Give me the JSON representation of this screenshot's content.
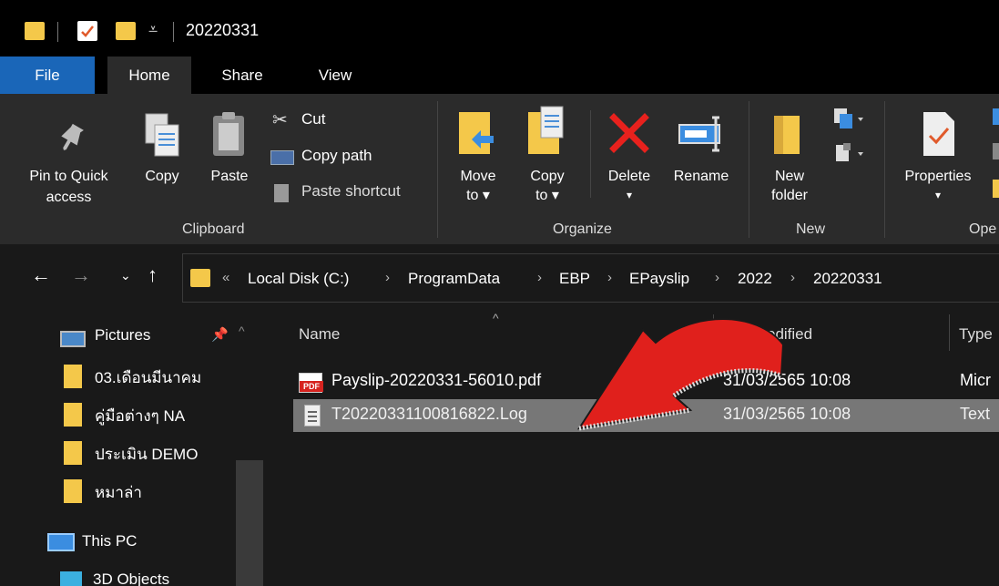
{
  "window": {
    "title": "20220331"
  },
  "tabs": [
    {
      "label": "File"
    },
    {
      "label": "Home"
    },
    {
      "label": "Share"
    },
    {
      "label": "View"
    }
  ],
  "ribbon": {
    "clipboard": {
      "pin_line1": "Pin to Quick",
      "pin_line2": "access",
      "copy": "Copy",
      "paste": "Paste",
      "cut": "Cut",
      "copy_path": "Copy path",
      "paste_shortcut": "Paste shortcut",
      "group": "Clipboard"
    },
    "organize": {
      "move_line1": "Move",
      "move_line2": "to ▾",
      "copy_line1": "Copy",
      "copy_line2": "to ▾",
      "delete": "Delete",
      "delete_arrow": "▾",
      "rename": "Rename",
      "group": "Organize"
    },
    "new": {
      "folder_line1": "New",
      "folder_line2": "folder",
      "group": "New"
    },
    "open": {
      "properties": "Properties",
      "properties_arrow": "▾",
      "group": "Ope"
    }
  },
  "address": {
    "overflow": "«",
    "crumbs": [
      "Local Disk (C:)",
      "ProgramData",
      "EBP",
      "EPayslip",
      "2022",
      "20220331"
    ],
    "sep": "›"
  },
  "sidebar": {
    "items": [
      {
        "label": "Pictures"
      },
      {
        "label": "03.เดือนมีนาคม"
      },
      {
        "label": "คู่มือต่างๆ NA"
      },
      {
        "label": "ประเมิน DEMO"
      },
      {
        "label": "หมาล่า"
      },
      {
        "label": "This PC"
      },
      {
        "label": "3D Objects"
      }
    ]
  },
  "filelist": {
    "columns": {
      "name": "Name",
      "modified": "odified",
      "type": "Type"
    },
    "rows": [
      {
        "name": "Payslip-20220331-56010.pdf",
        "date": "31/03/2565 10:08",
        "type": "Micr",
        "icon": "pdf-icon",
        "icon_text": "PDF"
      },
      {
        "name": "T20220331100816822.Log",
        "date": "31/03/2565 10:08",
        "type": "Text",
        "icon": "text-file-icon"
      }
    ]
  },
  "colors": {
    "file_tab": "#1a66b8",
    "ribbon": "#2b2b2b",
    "background": "#191919",
    "folder": "#f4c84a",
    "arrow": "#e0201c",
    "selection": "#777777"
  }
}
